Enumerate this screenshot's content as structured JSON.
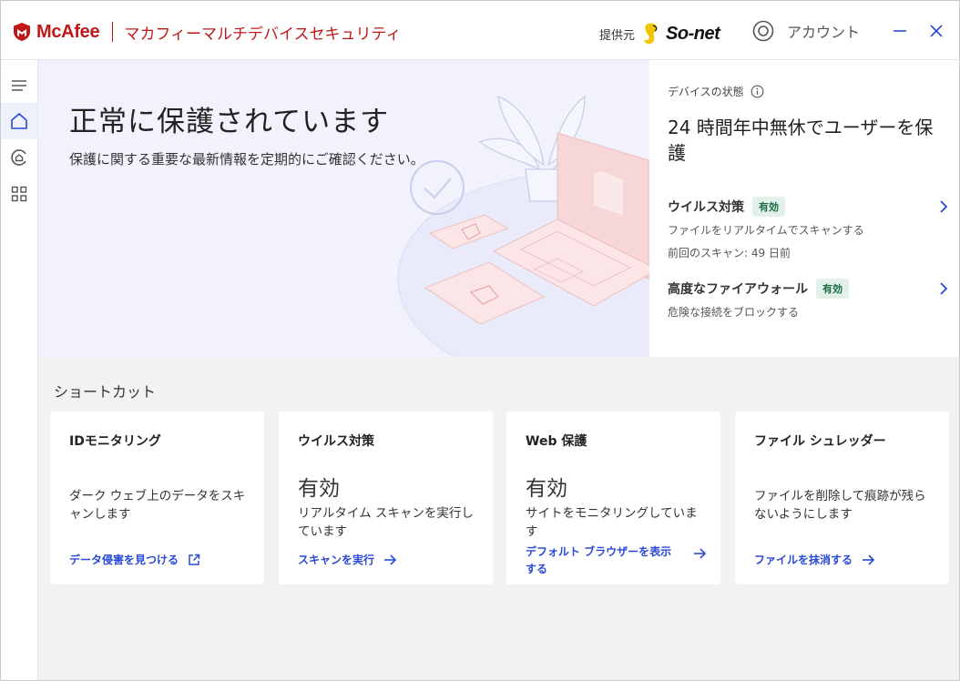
{
  "titlebar": {
    "brand_name": "McAfee",
    "product_name": "マカフィーマルチデバイスセキュリティ",
    "provider_label": "提供元",
    "provider_logo_text": "So-net",
    "account_label": "アカウント",
    "icons": {
      "brand": "mcafee-shield-icon",
      "account": "user-circle-icon",
      "minimize": "minimize-icon",
      "close": "close-icon"
    }
  },
  "sidebar": {
    "items": [
      {
        "icon": "menu-icon"
      },
      {
        "icon": "home-icon",
        "active": true
      },
      {
        "icon": "protection-icon"
      },
      {
        "icon": "apps-grid-icon"
      }
    ]
  },
  "hero": {
    "title": "正常に保護されています",
    "subtitle": "保護に関する重要な最新情報を定期的にご確認ください。"
  },
  "device_status": {
    "label": "デバイスの状態",
    "headline": "24 時間年中無休でユーザーを保護",
    "items": [
      {
        "name": "ウイルス対策",
        "badge": "有効",
        "desc1": "ファイルをリアルタイムでスキャンする",
        "desc2": "前回のスキャン: 49 日前"
      },
      {
        "name": "高度なファイアウォール",
        "badge": "有効",
        "desc1": "危険な接続をブロックする"
      }
    ]
  },
  "shortcuts": {
    "heading": "ショートカット",
    "cards": [
      {
        "title": "IDモニタリング",
        "desc": "ダーク ウェブ上のデータをスキャンします",
        "link": "データ侵害を見つける",
        "link_icon": "external-link-icon"
      },
      {
        "title": "ウイルス対策",
        "status": "有効",
        "desc": "リアルタイム スキャンを実行しています",
        "link": "スキャンを実行",
        "link_icon": "arrow-right-icon"
      },
      {
        "title": "Web 保護",
        "status": "有効",
        "desc": "サイトをモニタリングしています",
        "link": "デフォルト ブラウザーを表示する",
        "link_icon": "arrow-right-icon"
      },
      {
        "title": "ファイル シュレッダー",
        "desc": "ファイルを削除して痕跡が残らないようにします",
        "link": "ファイルを抹消する",
        "link_icon": "arrow-right-icon"
      }
    ]
  },
  "colors": {
    "brand_red": "#c01818",
    "link_blue": "#2a49d8",
    "hero_bg": "#f1f2fc",
    "badge_bg": "#e3f0ea",
    "badge_text": "#1b6b45",
    "content_bg": "#f2f2f2"
  }
}
